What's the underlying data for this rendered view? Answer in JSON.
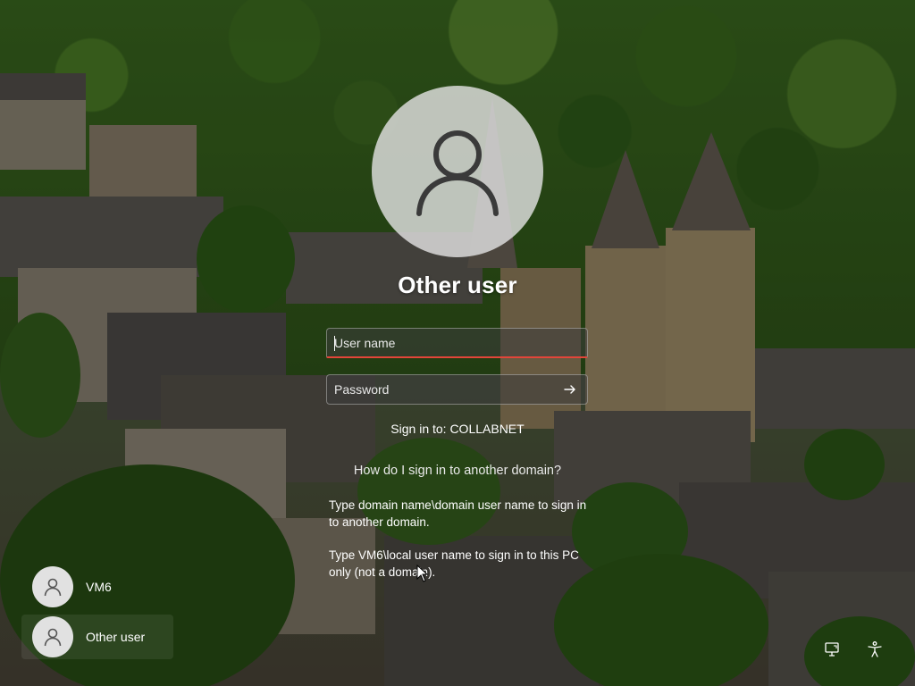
{
  "login": {
    "title": "Other user",
    "username_placeholder": "User name",
    "password_placeholder": "Password",
    "sign_in_to": "Sign in to: COLLABNET",
    "help_link": "How do I sign in to another domain?",
    "help_text_1": "Type domain name\\domain user name to sign in to another domain.",
    "help_text_2": "Type VM6\\local user name to sign in to this PC only (not a domain)."
  },
  "users": [
    {
      "label": "VM6"
    },
    {
      "label": "Other user"
    }
  ],
  "icons": {
    "avatar": "user-avatar-icon",
    "submit": "arrow-right-icon",
    "network": "network-icon",
    "accessibility": "accessibility-icon"
  },
  "colors": {
    "focus_underline": "#e3453a",
    "avatar_bg": "#e1e1e1"
  }
}
